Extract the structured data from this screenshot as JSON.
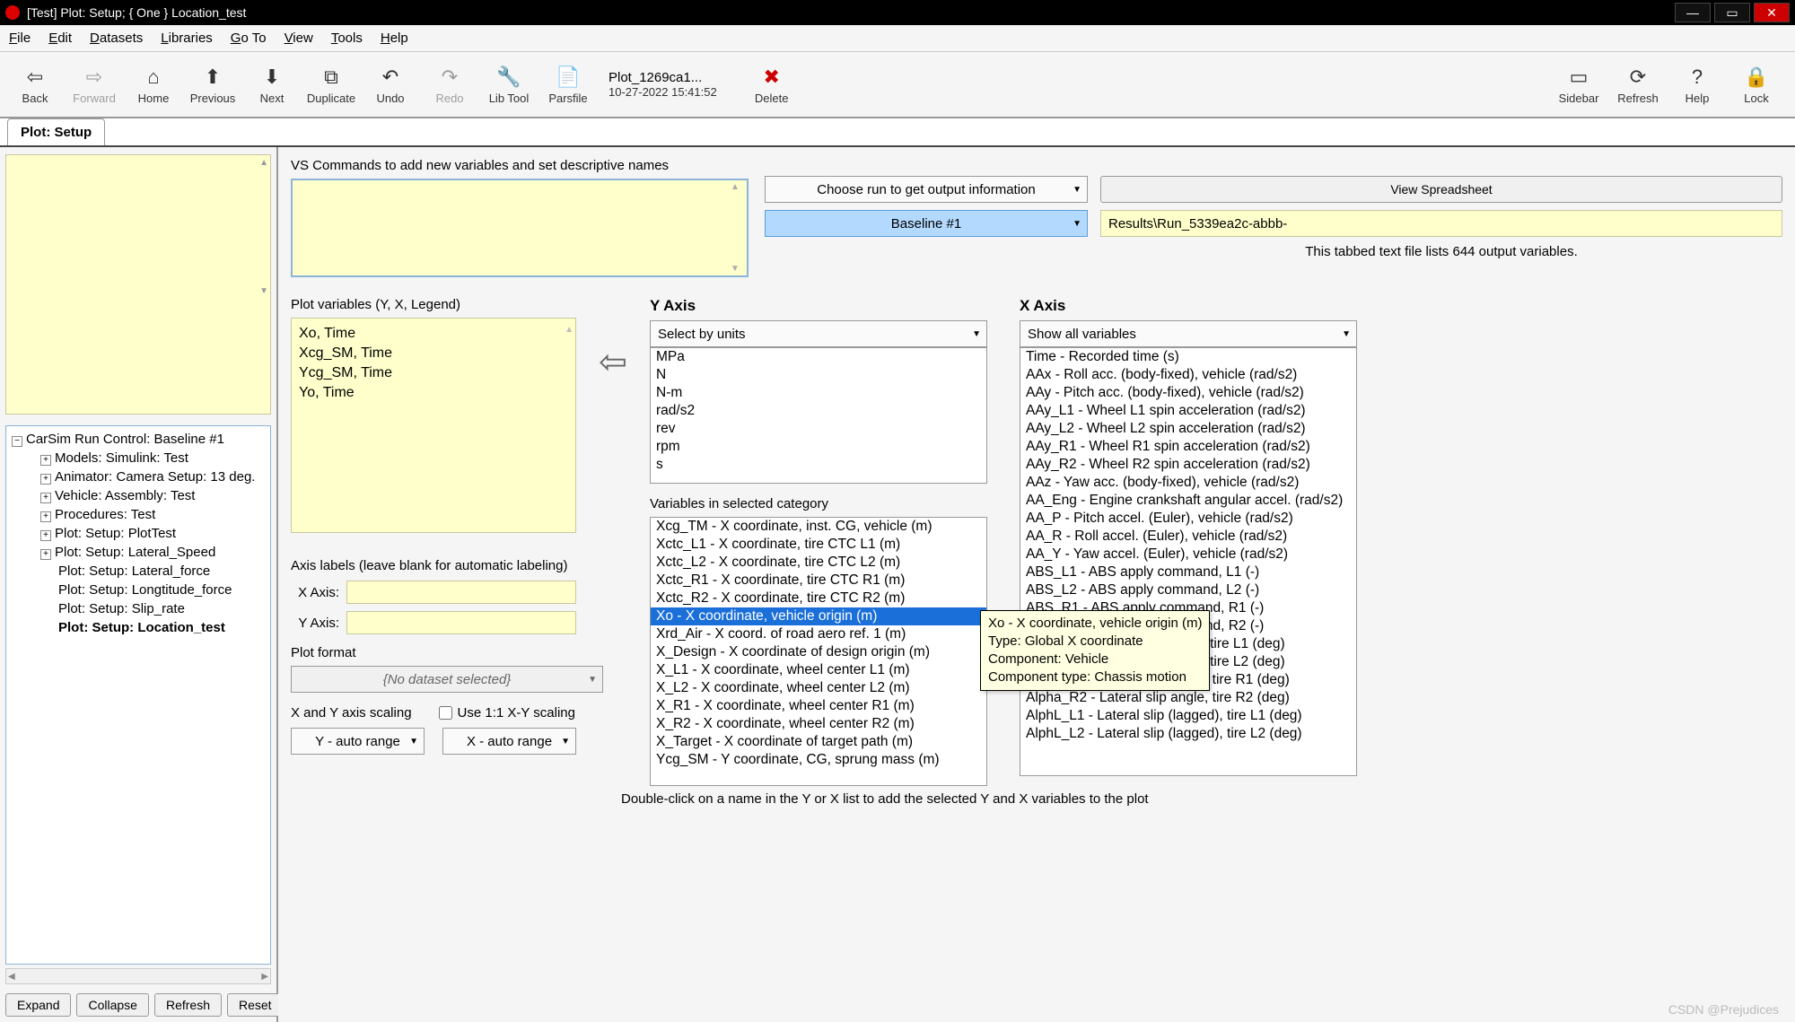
{
  "window": {
    "title": "[Test] Plot: Setup; { One } Location_test"
  },
  "menu": [
    "File",
    "Edit",
    "Datasets",
    "Libraries",
    "Go To",
    "View",
    "Tools",
    "Help"
  ],
  "toolbar": {
    "back": "Back",
    "forward": "Forward",
    "home": "Home",
    "previous": "Previous",
    "next": "Next",
    "duplicate": "Duplicate",
    "undo": "Undo",
    "redo": "Redo",
    "libtool": "Lib Tool",
    "parsfile": "Parsfile",
    "delete": "Delete",
    "sidebar": "Sidebar",
    "refresh": "Refresh",
    "help": "Help",
    "lock": "Lock",
    "file_name": "Plot_1269ca1...",
    "file_date": "10-27-2022 15:41:52"
  },
  "tab_title": "Plot: Setup",
  "tree": {
    "root": "CarSim Run Control: Baseline #1",
    "nodes": [
      "Models: Simulink: Test",
      "Animator: Camera Setup: 13 deg.",
      "Vehicle: Assembly: Test",
      "Procedures: Test",
      "Plot: Setup: PlotTest",
      "Plot: Setup: Lateral_Speed"
    ],
    "leaves": [
      "Plot: Setup: Lateral_force",
      "Plot: Setup: Longtitude_force",
      "Plot: Setup: Slip_rate"
    ],
    "selected": "Plot: Setup: Location_test",
    "buttons": {
      "expand": "Expand",
      "collapse": "Collapse",
      "refresh": "Refresh",
      "reset": "Reset"
    }
  },
  "vs_label": "VS Commands to add new variables and set descriptive names",
  "run_combo": "Choose run to get output information",
  "baseline": "Baseline #1",
  "spreadsheet_btn": "View  Spreadsheet",
  "results_path": "Results\\Run_5339ea2c-abbb-",
  "info_count": "This tabbed text file lists 644 output variables.",
  "plotvars_label": "Plot variables  (Y, X, Legend)",
  "plotvars": [
    "Xo, Time",
    "Xcg_SM, Time",
    "Ycg_SM, Time",
    "Yo, Time"
  ],
  "axis_labels_header": "Axis labels (leave blank for automatic labeling)",
  "xaxis_lbl": "X Axis:",
  "yaxis_lbl": "Y Axis:",
  "plot_format_header": "Plot format",
  "plot_format_value": "{No dataset selected}",
  "scaling_header": "X and Y axis scaling",
  "use11": "Use 1:1 X-Y scaling",
  "yscale": "Y - auto range",
  "xscale": "X - auto range",
  "yaxis_title": "Y Axis",
  "xaxis_title": "X Axis",
  "y_units_combo": "Select by units",
  "y_units": [
    "MPa",
    "N",
    "N-m",
    "rad/s2",
    "rev",
    "rpm",
    "s"
  ],
  "y_vars_label": "Variables in selected category",
  "y_vars": [
    "Xcg_TM - X coordinate, inst. CG, vehicle (m)",
    "Xctc_L1 - X coordinate, tire CTC L1 (m)",
    "Xctc_L2 - X coordinate, tire CTC L2 (m)",
    "Xctc_R1 - X coordinate, tire CTC R1 (m)",
    "Xctc_R2 - X coordinate, tire CTC R2 (m)",
    "Xo - X coordinate, vehicle origin (m)",
    "Xrd_Air - X coord. of road aero ref. 1 (m)",
    "X_Design - X coordinate of design origin (m)",
    "X_L1 - X coordinate, wheel center L1 (m)",
    "X_L2 - X coordinate, wheel center L2 (m)",
    "X_R1 - X coordinate, wheel center R1 (m)",
    "X_R2 - X coordinate, wheel center R2 (m)",
    "X_Target - X coordinate of target path (m)",
    "Ycg_SM - Y coordinate, CG, sprung mass (m)"
  ],
  "y_vars_selected_index": 5,
  "x_combo": "Show all variables",
  "x_vars": [
    "Time - Recorded time (s)",
    "AAx - Roll acc. (body-fixed), vehicle (rad/s2)",
    "AAy - Pitch acc. (body-fixed), vehicle (rad/s2)",
    "AAy_L1 - Wheel L1 spin acceleration (rad/s2)",
    "AAy_L2 - Wheel L2 spin acceleration (rad/s2)",
    "AAy_R1 - Wheel R1 spin acceleration (rad/s2)",
    "AAy_R2 - Wheel R2 spin acceleration (rad/s2)",
    "AAz - Yaw acc. (body-fixed), vehicle (rad/s2)",
    "AA_Eng - Engine crankshaft angular accel. (rad/s2)",
    "AA_P - Pitch accel. (Euler), vehicle (rad/s2)",
    "AA_R - Roll accel. (Euler), vehicle (rad/s2)",
    "AA_Y - Yaw accel. (Euler), vehicle (rad/s2)",
    "ABS_L1 - ABS apply command, L1 (-)",
    "ABS_L2 - ABS apply command, L2 (-)",
    "ABS_R1 - ABS apply command, R1 (-)",
    "ABS_R2 - ABS apply command, R2 (-)",
    "Alpha_L1 - Lateral slip angle, tire L1 (deg)",
    "Alpha_L2 - Lateral slip angle, tire L2 (deg)",
    "Alpha_R1 - Lateral slip angle, tire R1 (deg)",
    "Alpha_R2 - Lateral slip angle, tire R2 (deg)",
    "AlphL_L1 - Lateral slip (lagged), tire L1 (deg)",
    "AlphL_L2 - Lateral slip (lagged), tire L2 (deg)"
  ],
  "tooltip": [
    "Xo - X coordinate, vehicle origin (m)",
    "Type: Global X coordinate",
    "Component: Vehicle",
    "Component type: Chassis motion"
  ],
  "footer": "Double-click on a name in the Y or X list to add the selected Y and X variables to the plot",
  "watermark": "CSDN @Prejudices"
}
